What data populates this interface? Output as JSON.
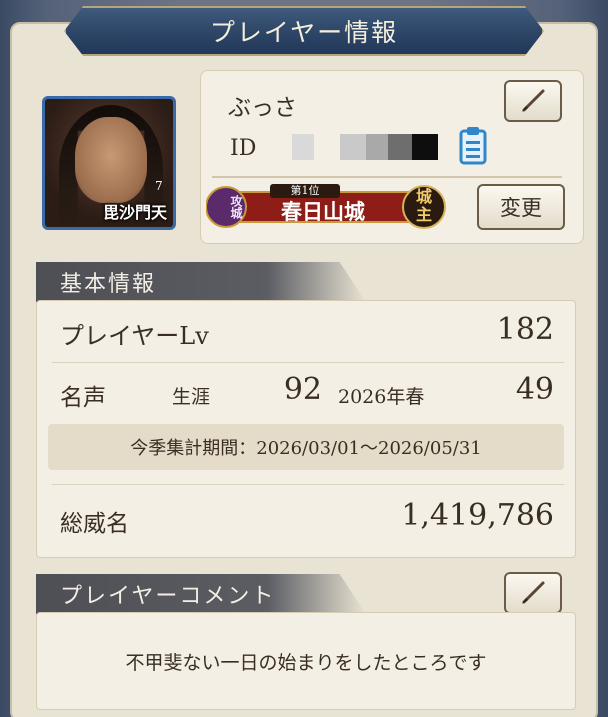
{
  "title": "プレイヤー情報",
  "player": {
    "name": "ぶっさ",
    "id_label": "ID",
    "avatar_name": "毘沙門天",
    "avatar_badge": "7"
  },
  "rank": {
    "prefix": "攻城",
    "rank_text": "第1位",
    "castle": "春日山城",
    "suffix": "城主"
  },
  "buttons": {
    "change": "変更"
  },
  "basic_info": {
    "header": "基本情報",
    "player_lv_label": "プレイヤーLv",
    "player_lv_value": "182",
    "fame_label": "名声",
    "career_label": "生涯",
    "career_value": "92",
    "season_label": "2026年春",
    "season_value": "49",
    "period_text": "今季集計期間：2026/03/01～2026/05/31",
    "total_label": "総威名",
    "total_value": "1,419,786"
  },
  "comment": {
    "header": "プレイヤーコメント",
    "text": "不甲斐ない一日の始まりをしたところです"
  }
}
